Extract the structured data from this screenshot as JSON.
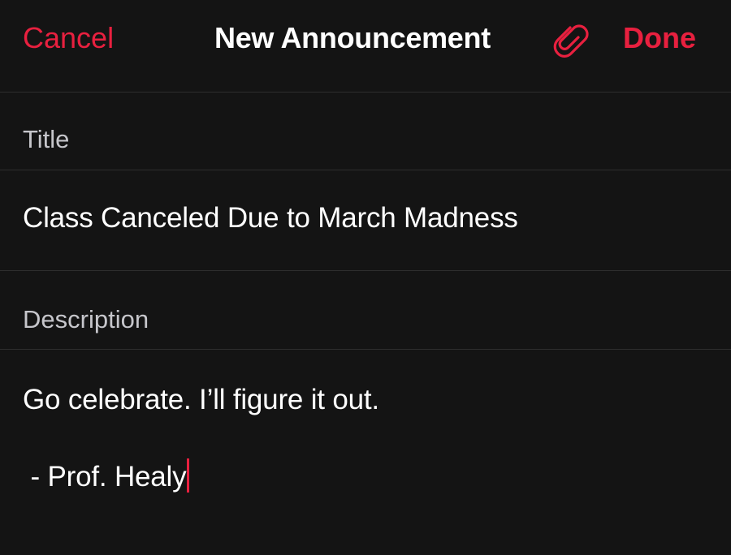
{
  "nav": {
    "cancel_label": "Cancel",
    "title": "New Announcement",
    "attach_icon": "paperclip-icon",
    "done_label": "Done"
  },
  "form": {
    "title_label": "Title",
    "title_value": "Class Canceled Due to March Madness",
    "description_label": "Description",
    "description_lines": [
      "Go celebrate. I’ll figure it out.",
      " - Prof. Healy"
    ]
  },
  "colors": {
    "background": "#141414",
    "accent": "#e8203f",
    "label": "#c6c6cb",
    "divider": "#2e2e2e"
  }
}
